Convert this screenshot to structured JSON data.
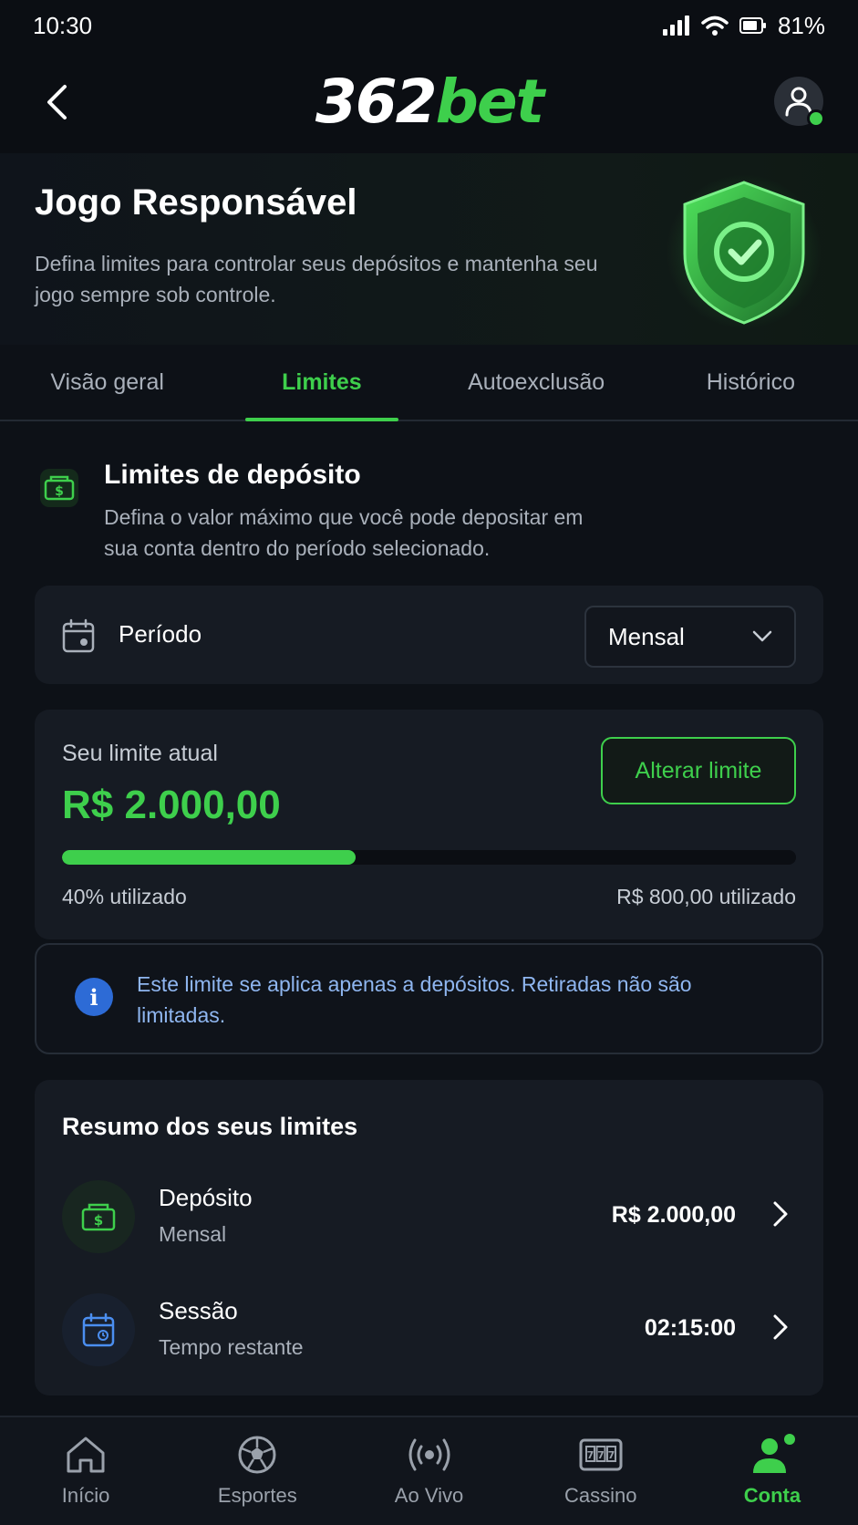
{
  "status_bar": {
    "time": "10:30",
    "battery": "81%"
  },
  "header": {
    "logo_number": "362",
    "logo_brand": "bet"
  },
  "hero": {
    "title": "Jogo Responsável",
    "description": "Defina limites para controlar seus depósitos e mantenha seu jogo sempre sob controle."
  },
  "tabs": [
    {
      "label": "Visão geral"
    },
    {
      "label": "Limites"
    },
    {
      "label": "Autoexclusão"
    },
    {
      "label": "Histórico"
    }
  ],
  "active_tab": "Limites",
  "deposit_limits": {
    "title": "Limites de depósito",
    "description": "Defina o valor máximo que você pode depositar em sua conta dentro do período selecionado."
  },
  "period": {
    "label": "Período",
    "selected": "Mensal"
  },
  "current_limit": {
    "label": "Seu limite atual",
    "value": "R$ 2.000,00",
    "change_button": "Alterar limite",
    "used_percent_text": "40% utilizado",
    "used_amount_text": "R$ 800,00 utilizado",
    "used_fraction": 0.4
  },
  "info": {
    "text": "Este limite se aplica apenas a depósitos. Retiradas não são limitadas."
  },
  "summary": {
    "title": "Resumo dos seus limites",
    "rows": [
      {
        "title": "Depósito",
        "subtitle": "Mensal",
        "value": "R$ 2.000,00"
      },
      {
        "title": "Sessão",
        "subtitle": "Tempo restante",
        "value": "02:15:00"
      }
    ]
  },
  "bottom_nav": [
    {
      "label": "Início",
      "icon": "home-icon"
    },
    {
      "label": "Esportes",
      "icon": "soccer-ball-icon"
    },
    {
      "label": "Ao Vivo",
      "icon": "live-broadcast-icon"
    },
    {
      "label": "Cassino",
      "icon": "slot-machine-icon"
    },
    {
      "label": "Conta",
      "icon": "user-icon"
    }
  ],
  "colors": {
    "accent": "#3ecf4c",
    "background": "#0d1117",
    "info": "#2d6bd6"
  }
}
